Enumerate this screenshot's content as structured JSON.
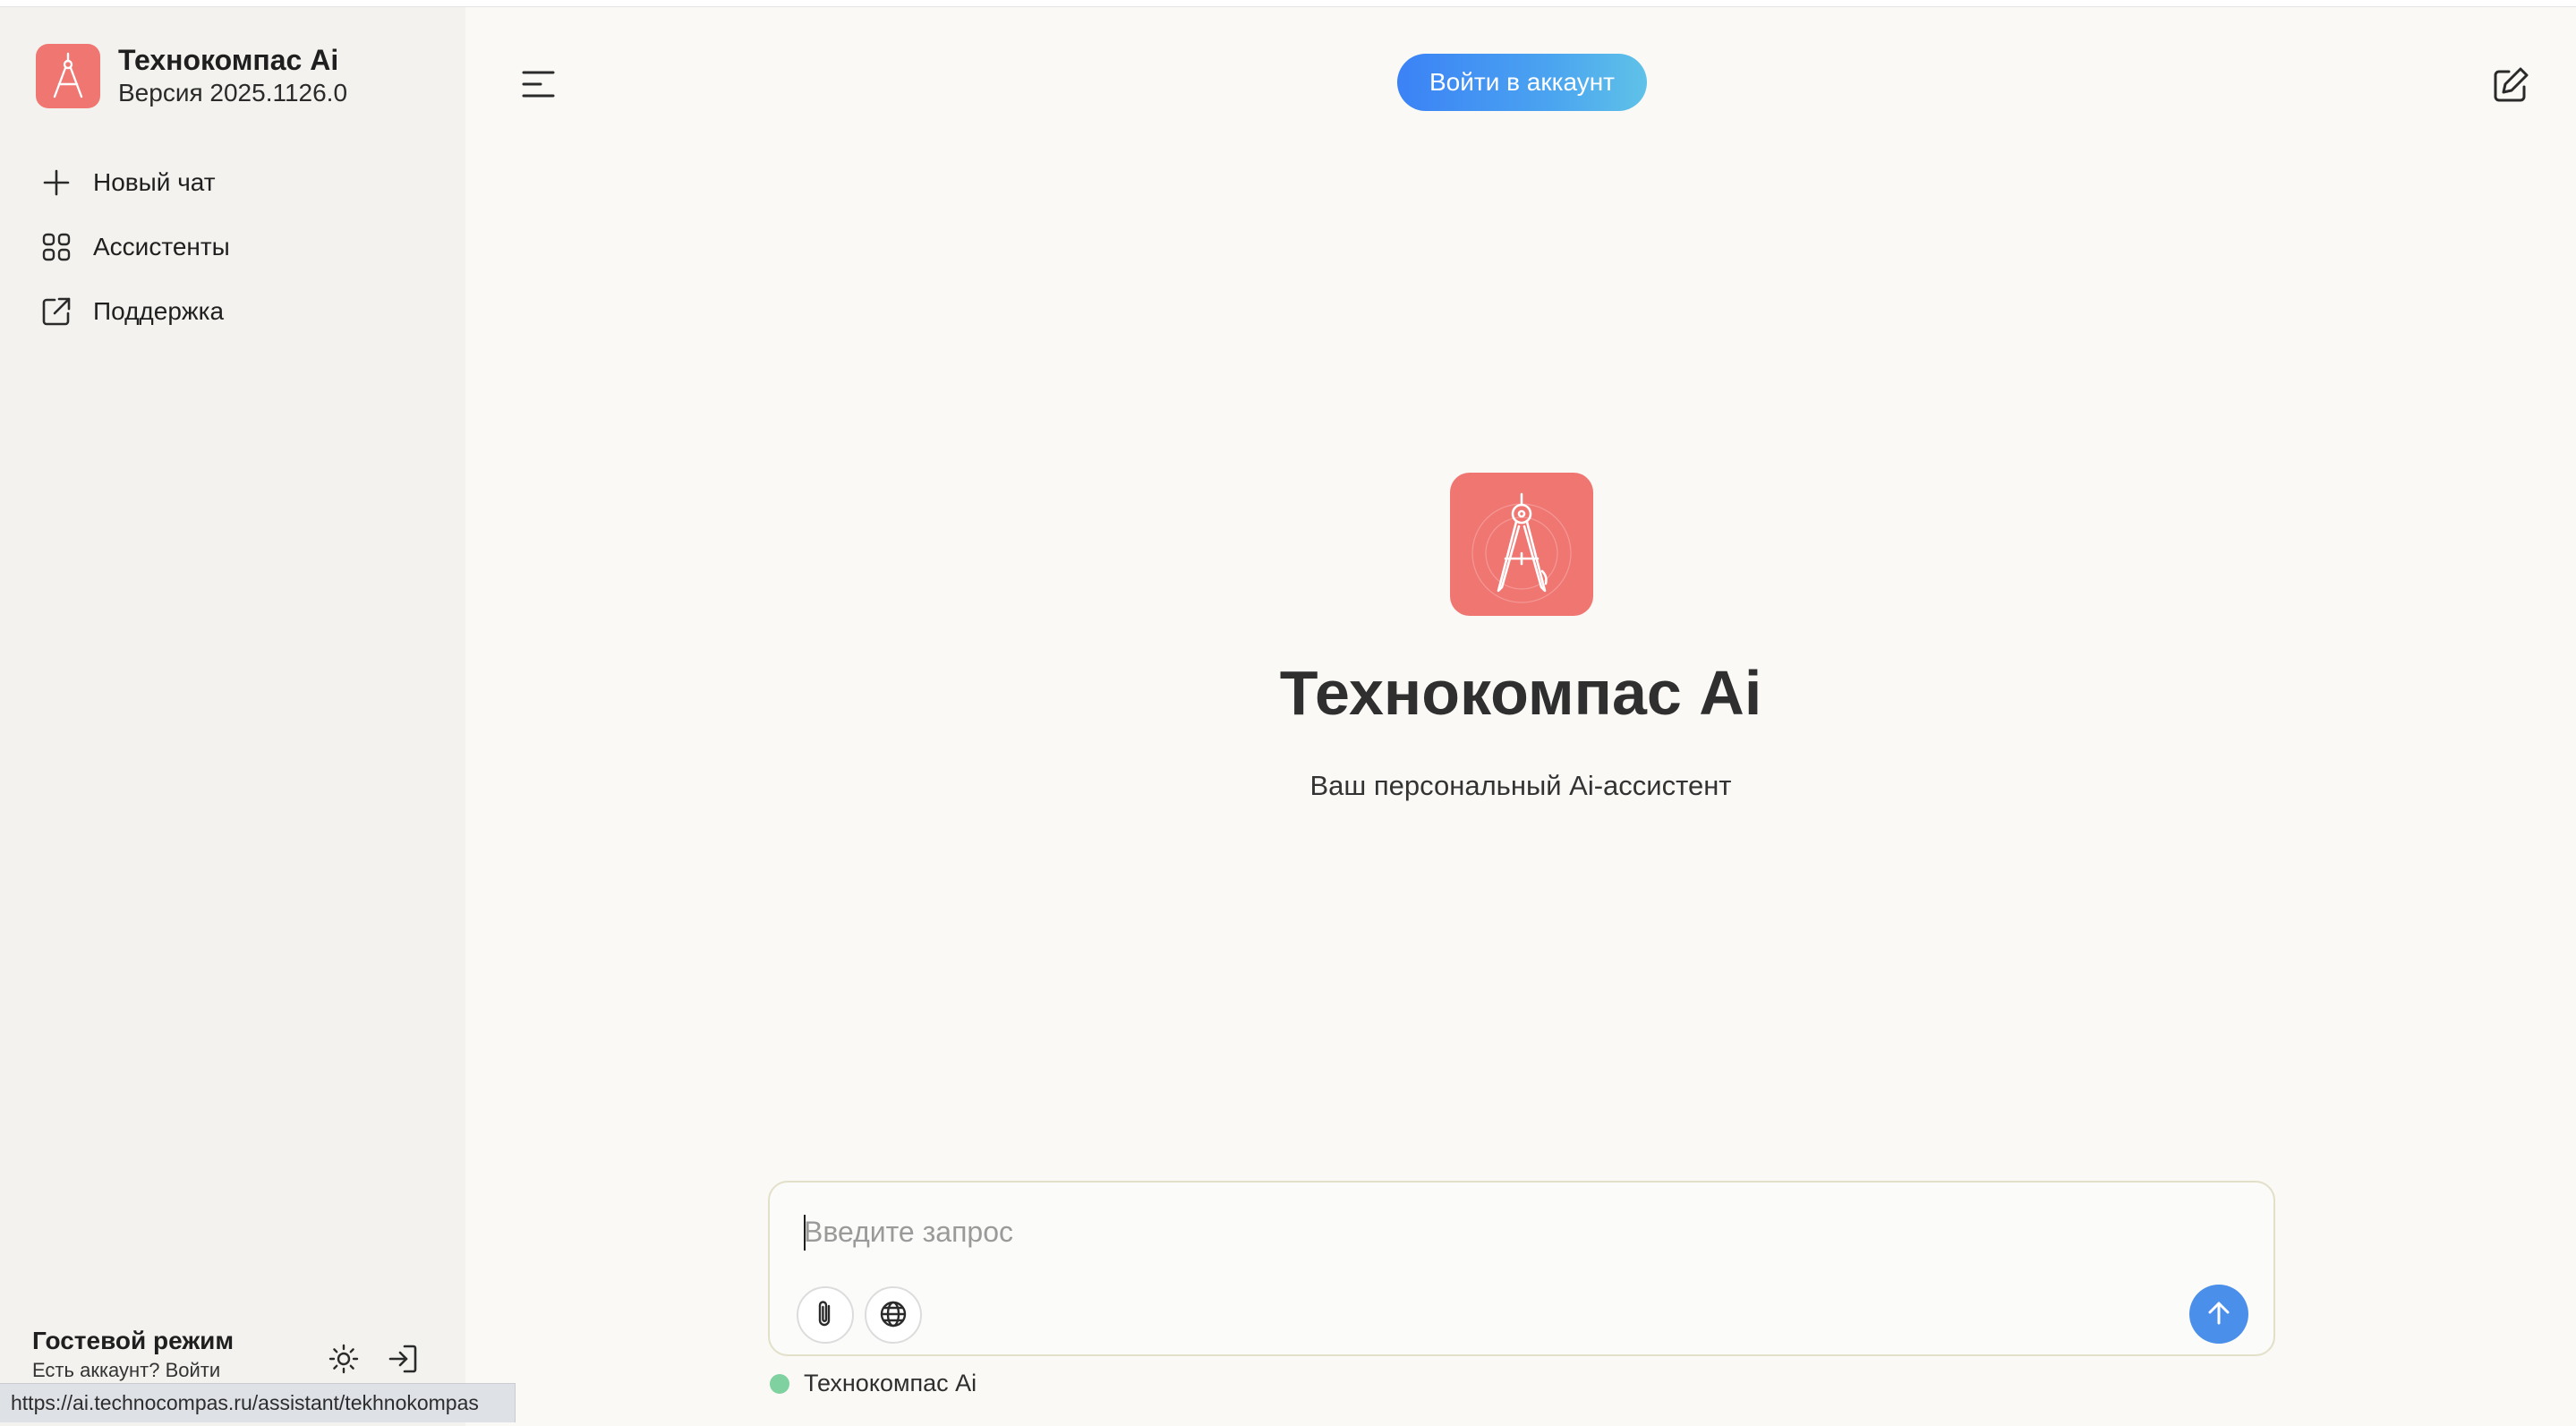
{
  "app": {
    "title": "Технокомпас Ai",
    "version": "Версия 2025.1126.0",
    "accent_color": "#f07672"
  },
  "sidebar": {
    "items": [
      {
        "label": "Новый чат",
        "icon": "plus-icon"
      },
      {
        "label": "Ассистенты",
        "icon": "grid-icon"
      },
      {
        "label": "Поддержка",
        "icon": "external-link-icon"
      }
    ],
    "guest": {
      "title": "Гостевой режим",
      "subtitle": "Есть аккаунт? Войти"
    }
  },
  "header": {
    "login_label": "Войти в аккаунт",
    "login_gradient": [
      "#3b82f6",
      "#5fc2e8"
    ]
  },
  "hero": {
    "title": "Технокомпас Ai",
    "subtitle": "Ваш персональный Ai-ассистент"
  },
  "composer": {
    "placeholder": "Введите запрос",
    "send_color": "#4a8fe9"
  },
  "model": {
    "name": "Технокомпас Ai",
    "status_color": "#7fd1a0"
  },
  "status_bar": {
    "url": "https://ai.technocompas.ru/assistant/tekhnokompas"
  }
}
